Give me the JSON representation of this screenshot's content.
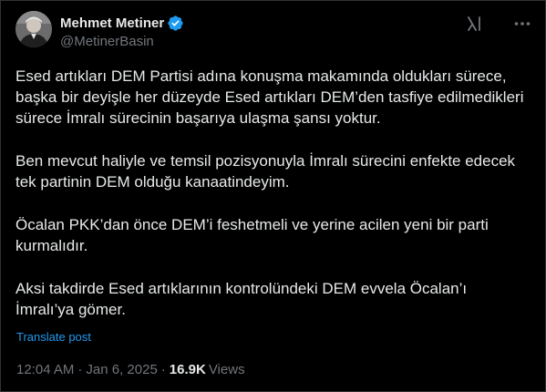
{
  "author": {
    "display_name": "Mehmet Metiner",
    "handle": "@MetinerBasin"
  },
  "icons": {
    "verified": "verified-badge-icon",
    "grok": "grok-icon",
    "more": "more-options-icon"
  },
  "colors": {
    "background": "#000000",
    "text": "#e7e9ea",
    "secondary_text": "#71767b",
    "link": "#1d9bf0",
    "verified_badge": "#1d9bf0"
  },
  "tweet": {
    "paragraphs": [
      "Esed artıkları DEM Partisi adına konuşma makamında oldukları sürece, başka bir deyişle her düzeyde Esed artıkları DEM’den tasfiye edilmedikleri sürece İmralı sürecinin başarıya ulaşma şansı yoktur.",
      "Ben mevcut haliyle ve temsil pozisyonuyla İmralı sürecini enfekte edecek tek partinin DEM olduğu kanaatindeyim.",
      "Öcalan PKK’dan önce DEM’i feshetmeli ve yerine acilen yeni bir parti kurmalıdır.",
      "Aksi takdirde Esed artıklarının kontrolündeki DEM evvela Öcalan’ı İmralı’ya gömer."
    ],
    "translate_label": "Translate post"
  },
  "meta": {
    "time": "12:04 AM",
    "separator": "·",
    "date": "Jan 6, 2025",
    "views_count": "16.9K",
    "views_label": "Views"
  }
}
